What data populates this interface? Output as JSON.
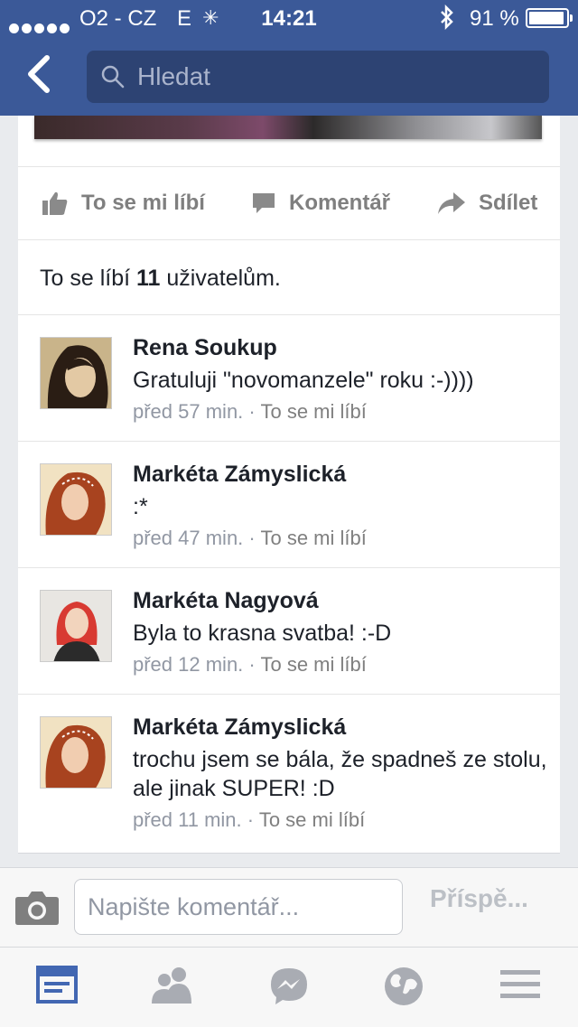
{
  "status": {
    "carrier": "O2 - CZ",
    "network": "E",
    "time": "14:21",
    "battery": "91 %"
  },
  "search": {
    "placeholder": "Hledat"
  },
  "actions": {
    "like": "To se mi líbí",
    "comment": "Komentář",
    "share": "Sdílet"
  },
  "likes": {
    "prefix": "To se líbí",
    "count": "11",
    "suffix": "uživatelům."
  },
  "comments": [
    {
      "name": "Rena Soukup",
      "text": "Gratuluji \"novomanzele\" roku :-))))",
      "time": "před 57 min.",
      "sep": "·",
      "like": "To se mi líbí"
    },
    {
      "name": "Markéta Zámyslická",
      "text": ":*",
      "time": "před 47 min.",
      "sep": "·",
      "like": "To se mi líbí"
    },
    {
      "name": "Markéta Nagyová",
      "text": "Byla to krasna svatba! :-D",
      "time": "před 12 min.",
      "sep": "·",
      "like": "To se mi líbí"
    },
    {
      "name": "Markéta Zámyslická",
      "text": "trochu jsem se bála, že spadneš ze stolu, ale jinak SUPER! :D",
      "time": "před 11 min.",
      "sep": "·",
      "like": "To se mi líbí"
    }
  ],
  "composer": {
    "placeholder": "Napište komentář...",
    "post": "Příspě..."
  },
  "colors": {
    "brand": "#3b5998",
    "active_tab": "#4267b2"
  },
  "tabs": [
    "news-feed-icon",
    "friends-icon",
    "messenger-icon",
    "globe-icon",
    "menu-icon"
  ]
}
